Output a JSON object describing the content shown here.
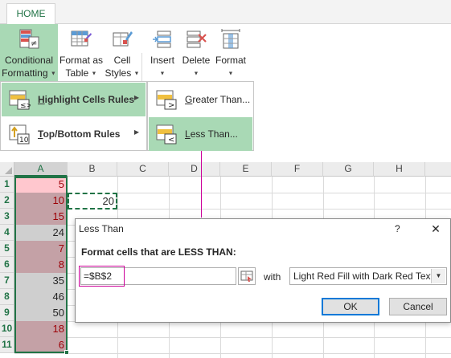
{
  "ribbon": {
    "tab": "HOME",
    "buttons": [
      {
        "line1": "Conditional",
        "line2": "Formatting",
        "icon": "conditional-formatting-icon"
      },
      {
        "line1": "Format as",
        "line2": "Table",
        "icon": "format-as-table-icon"
      },
      {
        "line1": "Cell",
        "line2": "Styles",
        "icon": "cell-styles-icon"
      },
      {
        "line1": "Insert",
        "line2": "",
        "icon": "insert-cells-icon"
      },
      {
        "line1": "Delete",
        "line2": "",
        "icon": "delete-cells-icon"
      },
      {
        "line1": "Format",
        "line2": "",
        "icon": "format-cells-icon"
      }
    ]
  },
  "menu": {
    "items": [
      {
        "pre": "",
        "ul": "H",
        "post": "ighlight Cells Rules",
        "icon": "highlight-cells-icon"
      },
      {
        "pre": "",
        "ul": "T",
        "post": "op/Bottom Rules",
        "icon": "top-bottom-icon"
      }
    ],
    "submenu": [
      {
        "pre": "",
        "ul": "G",
        "post": "reater Than...",
        "icon": "greater-than-icon"
      },
      {
        "pre": "",
        "ul": "L",
        "post": "ess Than...",
        "icon": "less-than-icon"
      }
    ]
  },
  "grid": {
    "columns": [
      "A",
      "B",
      "C",
      "D",
      "E",
      "F",
      "G",
      "H"
    ],
    "rows": [
      "1",
      "2",
      "3",
      "4",
      "5",
      "6",
      "7",
      "8",
      "9",
      "10",
      "11"
    ],
    "column_a": [
      "5",
      "10",
      "15",
      "24",
      "7",
      "8",
      "35",
      "46",
      "50",
      "18",
      "6"
    ],
    "b2": "20"
  },
  "colors": {
    "accent": "#217346",
    "highlight_fill": "#ffc7ce",
    "highlight_text": "#9c0006",
    "menu_active": "#a9d9b5",
    "annotation": "#cc0099"
  },
  "dialog": {
    "title": "Less Than",
    "help": "?",
    "close": "✕",
    "prompt": "Format cells that are LESS THAN:",
    "value": "=$B$2",
    "with_label": "with",
    "format_option": "Light Red Fill with Dark Red Text",
    "ok": "OK",
    "cancel": "Cancel"
  }
}
